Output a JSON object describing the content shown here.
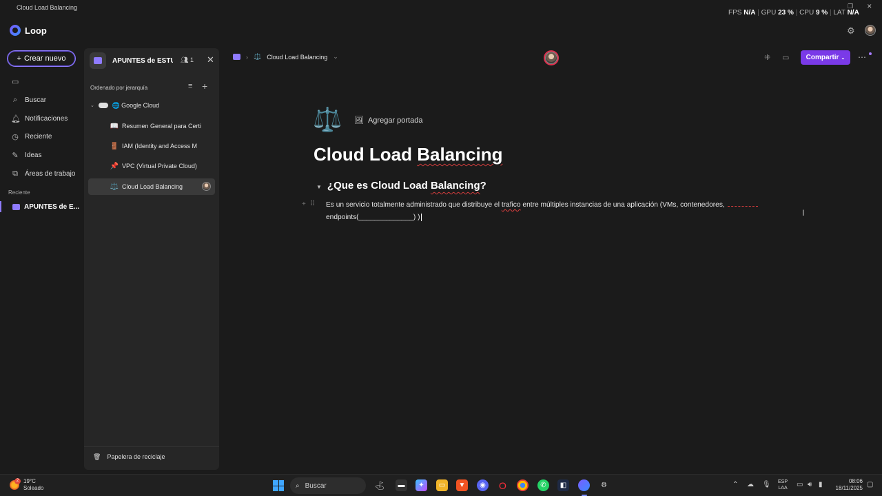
{
  "window": {
    "title": "Cloud Load Balancing"
  },
  "perf": {
    "fps_label": "FPS",
    "fps_value": "N/A",
    "gpu_label": "GPU",
    "gpu_value": "23 %",
    "cpu_label": "CPU",
    "cpu_value": "9 %",
    "lat_label": "LAT",
    "lat_value": "N/A"
  },
  "app": {
    "name": "Loop"
  },
  "leftnav": {
    "create_label": "Crear nuevo",
    "items": [
      {
        "label": "Buscar",
        "icon": "search-icon"
      },
      {
        "label": "Notificaciones",
        "icon": "bell-icon"
      },
      {
        "label": "Reciente",
        "icon": "clock-icon"
      },
      {
        "label": "Ideas",
        "icon": "pen-icon"
      },
      {
        "label": "Áreas de trabajo",
        "icon": "workspaces-icon"
      }
    ],
    "recent_label": "Reciente",
    "recent_item": "APUNTES de E..."
  },
  "sidepanel": {
    "workspace_title": "APUNTES de ESTU...",
    "members_count": "1",
    "sort_label": "Ordenado por jerarquía",
    "tree": [
      {
        "label": "Google Cloud",
        "emoji": "🌐"
      },
      {
        "label": "Resumen General para Certi",
        "emoji": "📖"
      },
      {
        "label": "IAM (Identity and Access M",
        "emoji": "🚪"
      },
      {
        "label": "VPC (Virtual Private Cloud)",
        "emoji": "📌"
      },
      {
        "label": "Cloud Load Balancing",
        "emoji": "⚖️"
      }
    ],
    "recycle_label": "Papelera de reciclaje"
  },
  "main": {
    "breadcrumb_page": "Cloud Load Balancing",
    "share_label": "Compartir",
    "add_cover_label": "Agregar portada",
    "doc_title_a": "Cloud Load ",
    "doc_title_b": "Balancing",
    "heading_a": "¿Que es Cloud Load ",
    "heading_b": "Balancing",
    "heading_c": "?",
    "para_a": "Es un servicio totalmente administrado que distribuye el ",
    "para_b": "trafico",
    "para_c": " entre múltiples instancias de una aplicación (VMs, contenedores,",
    "para_d": "endpoints(______________) )"
  },
  "taskbar": {
    "temp": "19°C",
    "weather": "Soleado",
    "weather_badge": "2",
    "search_label": "Buscar",
    "lang1": "ESP",
    "lang2": "LAA",
    "time": "08:06",
    "date": "18/11/2025"
  }
}
